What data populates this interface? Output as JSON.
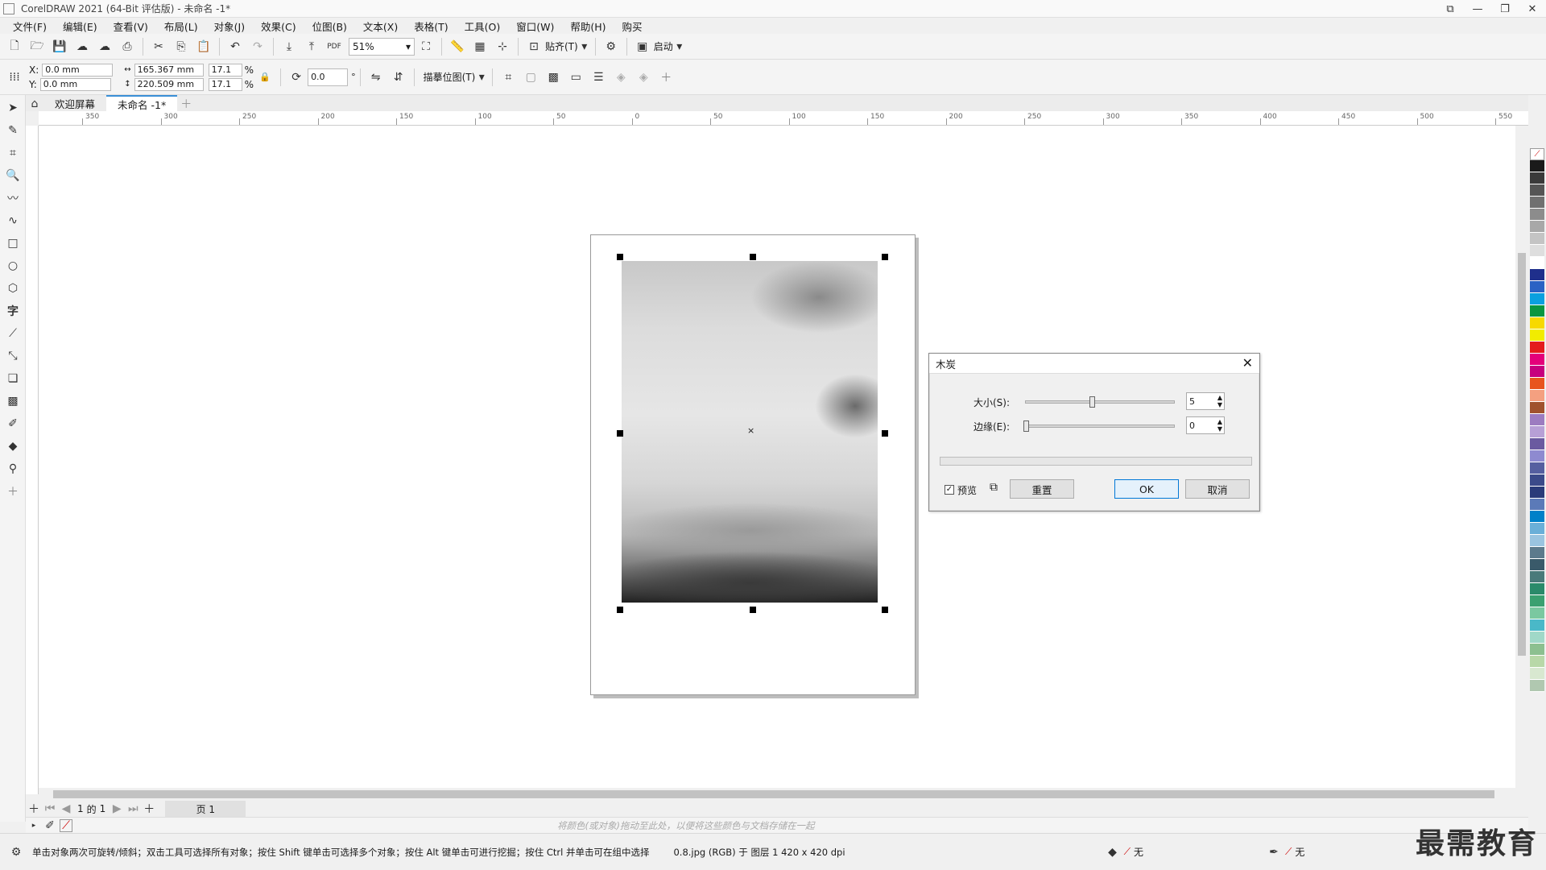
{
  "window": {
    "title": "CorelDRAW 2021 (64-Bit 评估版) - 未命名 -1*"
  },
  "menu": [
    "文件(F)",
    "编辑(E)",
    "查看(V)",
    "布局(L)",
    "对象(J)",
    "效果(C)",
    "位图(B)",
    "文本(X)",
    "表格(T)",
    "工具(O)",
    "窗口(W)",
    "帮助(H)",
    "购买"
  ],
  "toolbar": {
    "zoom": "51%",
    "snap_label": "贴齐(T)",
    "launch_label": "启动"
  },
  "properties": {
    "x_label": "X:",
    "y_label": "Y:",
    "x": "0.0 mm",
    "y": "0.0 mm",
    "width": "165.367 mm",
    "height": "220.509 mm",
    "scale_w": "17.1",
    "scale_h": "17.1",
    "percent": "%",
    "rotation": "0.0",
    "trace_label": "描摹位图(T)"
  },
  "tabs": {
    "welcome": "欢迎屏幕",
    "document": "未命名 -1*"
  },
  "ruler": {
    "h_labels": [
      "350",
      "300",
      "250",
      "200",
      "150",
      "100",
      "50",
      "0",
      "50",
      "100",
      "150",
      "200",
      "250",
      "300",
      "350",
      "400",
      "450",
      "500",
      "550"
    ]
  },
  "dialog": {
    "title": "木炭",
    "size_label": "大小(S):",
    "size_value": "5",
    "edge_label": "边缘(E):",
    "edge_value": "0",
    "preview_label": "预览",
    "reset_label": "重置",
    "ok_label": "OK",
    "cancel_label": "取消"
  },
  "pagenav": {
    "current": "1",
    "of_label": "的",
    "total": "1",
    "page_tab": "页 1"
  },
  "colorbar": {
    "hint": "将颜色(或对象)拖动至此处，以便将这些颜色与文档存储在一起"
  },
  "status": {
    "hint": "单击对象两次可旋转/倾斜；双击工具可选择所有对象；按住 Shift 键单击可选择多个对象；按住 Alt 键单击可进行挖掘；按住 Ctrl 并单击可在组中选择",
    "object_info": "0.8.jpg (RGB) 于 图层 1 420 x 420 dpi",
    "fill_none": "无",
    "outline_none": "无"
  },
  "watermark": "最需教育",
  "palette_colors": [
    "#1a1a1a",
    "#3a3a3a",
    "#555555",
    "#707070",
    "#8c8c8c",
    "#a8a8a8",
    "#c4c4c4",
    "#dedede",
    "#ffffff",
    "#1f2f8c",
    "#2b62c4",
    "#0aa0df",
    "#0a9640",
    "#f7d900",
    "#f1ec00",
    "#e41c1c",
    "#e4007a",
    "#c6007e",
    "#e8541e",
    "#f4a080",
    "#a0522d",
    "#9c7cc0",
    "#b7a0d6",
    "#6a5aa0",
    "#8e8ad0",
    "#555fa0",
    "#3b4a8a",
    "#2a3b7a",
    "#5b7ab8",
    "#0080c8",
    "#6aafd8",
    "#9ac4e0",
    "#5c7a8c",
    "#3a5a6a",
    "#4a7a7a",
    "#2a8a6a",
    "#3aa070",
    "#7ac8a0",
    "#4ab8c8",
    "#a0d8c8",
    "#8cc090",
    "#b8d8a8",
    "#d8e8d0",
    "#b0c8b0"
  ]
}
